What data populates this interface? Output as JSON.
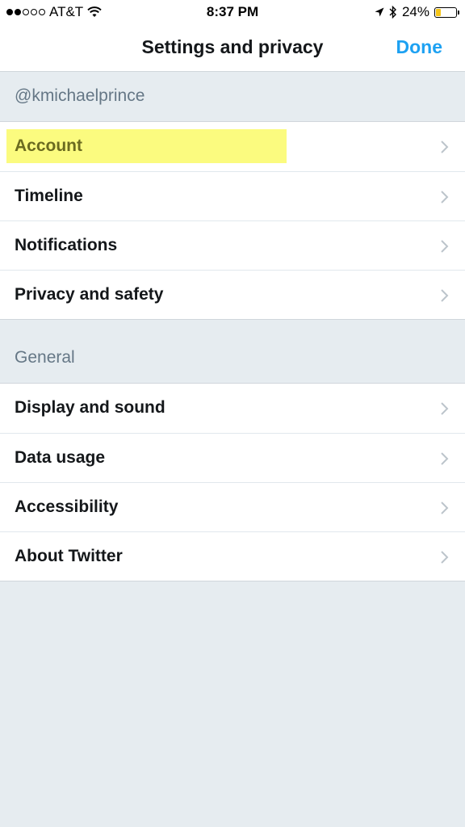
{
  "status_bar": {
    "carrier": "AT&T",
    "time": "8:37 PM",
    "battery": "24%",
    "battery_level": 0.24
  },
  "nav": {
    "title": "Settings and privacy",
    "done_label": "Done"
  },
  "account_section": {
    "header": "@kmichaelprince",
    "items": [
      {
        "label": "Account",
        "highlighted": true
      },
      {
        "label": "Timeline"
      },
      {
        "label": "Notifications"
      },
      {
        "label": "Privacy and safety"
      }
    ]
  },
  "general_section": {
    "header": "General",
    "items": [
      {
        "label": "Display and sound"
      },
      {
        "label": "Data usage"
      },
      {
        "label": "Accessibility"
      },
      {
        "label": "About Twitter"
      }
    ]
  },
  "colors": {
    "accent": "#1da1f2",
    "highlight": "#fbfb7f",
    "background": "#e6ecf0"
  }
}
